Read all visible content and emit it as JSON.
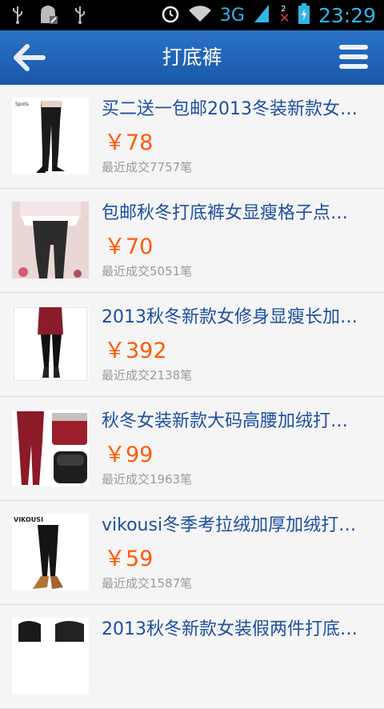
{
  "status": {
    "network": "3G",
    "sim_badge": "2",
    "time": "23:29"
  },
  "header": {
    "title": "打底裤"
  },
  "products": [
    {
      "title": "买二送一包邮2013冬装新款女…",
      "price": "￥78",
      "sales": "最近成交7757笔"
    },
    {
      "title": "包邮秋冬打底裤女显瘦格子点…",
      "price": "￥70",
      "sales": "最近成交5051笔"
    },
    {
      "title": "2013秋冬新款女修身显瘦长加…",
      "price": "￥392",
      "sales": "最近成交2138笔"
    },
    {
      "title": "秋冬女装新款大码高腰加绒打…",
      "price": "￥99",
      "sales": "最近成交1963笔"
    },
    {
      "title": "vikousi冬季考拉绒加厚加绒打…",
      "price": "￥59",
      "sales": "最近成交1587笔"
    },
    {
      "title": "2013秋冬新款女装假两件打底…",
      "price": "",
      "sales": ""
    }
  ],
  "thumb_labels": {
    "p1": "Spots",
    "p5": "VIKOUSI"
  }
}
